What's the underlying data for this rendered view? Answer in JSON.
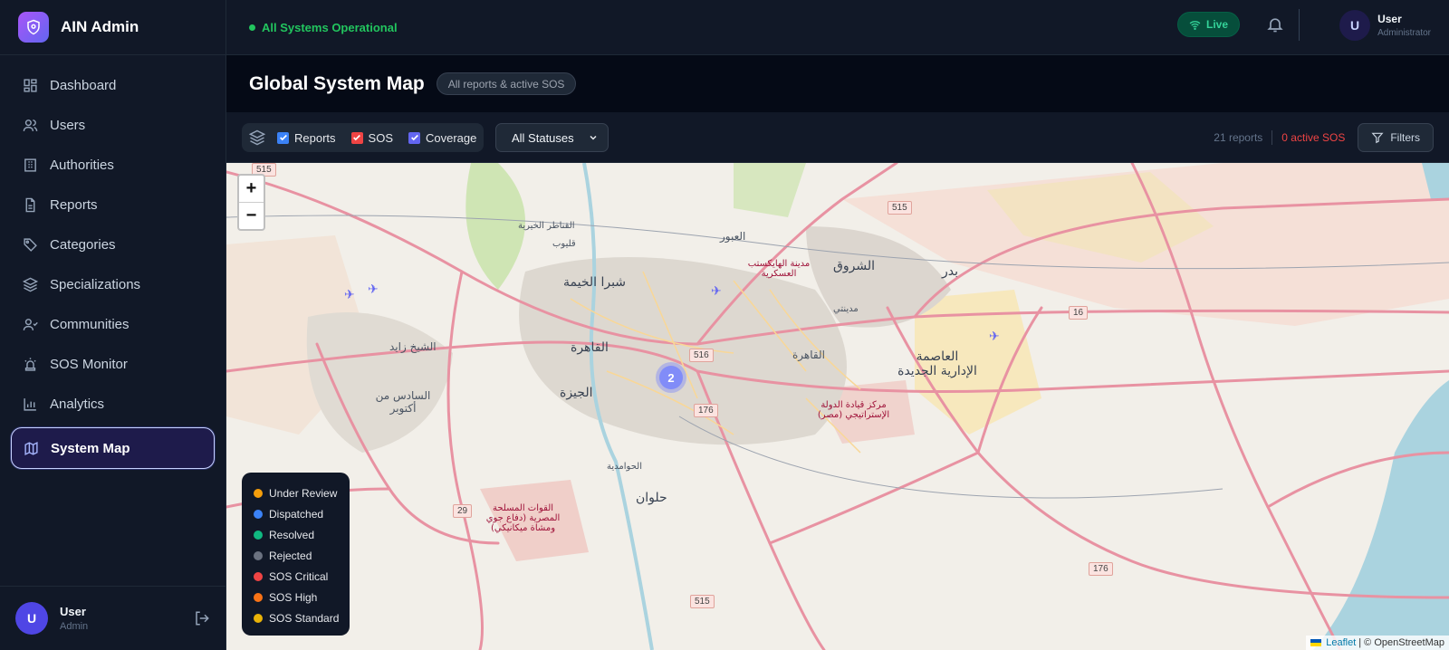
{
  "app": {
    "name": "AIN Admin"
  },
  "sidebar": {
    "items": [
      {
        "label": "Dashboard",
        "icon": "dashboard-icon"
      },
      {
        "label": "Users",
        "icon": "users-icon"
      },
      {
        "label": "Authorities",
        "icon": "building-icon"
      },
      {
        "label": "Reports",
        "icon": "file-icon"
      },
      {
        "label": "Categories",
        "icon": "tag-icon"
      },
      {
        "label": "Specializations",
        "icon": "layers-icon"
      },
      {
        "label": "Communities",
        "icon": "community-icon"
      },
      {
        "label": "SOS Monitor",
        "icon": "siren-icon"
      },
      {
        "label": "Analytics",
        "icon": "chart-icon"
      },
      {
        "label": "System Map",
        "icon": "map-icon",
        "active": true
      }
    ],
    "footer": {
      "avatar": "U",
      "name": "User",
      "role": "Admin"
    }
  },
  "topbar": {
    "status": "All Systems Operational",
    "live": "Live",
    "user": {
      "avatar": "U",
      "name": "User",
      "role": "Administrator"
    }
  },
  "page": {
    "title": "Global System Map",
    "subtitle": "All reports & active SOS"
  },
  "toolbar": {
    "layers": [
      {
        "label": "Reports",
        "checked": true,
        "color": "#3b82f6"
      },
      {
        "label": "SOS",
        "checked": true,
        "color": "#ef4444"
      },
      {
        "label": "Coverage",
        "checked": true,
        "color": "#6366f1"
      }
    ],
    "status_select": "All Statuses",
    "report_count": "21 reports",
    "sos_count": "0 active SOS",
    "filters": "Filters"
  },
  "map": {
    "zoom_in": "+",
    "zoom_out": "−",
    "cluster_count": "2",
    "legend": [
      {
        "label": "Under Review",
        "color": "#f59e0b"
      },
      {
        "label": "Dispatched",
        "color": "#3b82f6"
      },
      {
        "label": "Resolved",
        "color": "#10b981"
      },
      {
        "label": "Rejected",
        "color": "#6b7280"
      },
      {
        "label": "SOS Critical",
        "color": "#ef4444"
      },
      {
        "label": "SOS High",
        "color": "#f97316"
      },
      {
        "label": "SOS Standard",
        "color": "#eab308"
      }
    ],
    "attribution": {
      "leaflet": "Leaflet",
      "osm": "| © OpenStreetMap"
    },
    "labels": {
      "cairo": "القاهرة",
      "giza": "الجيزة",
      "shubra": "شبرا الخيمة",
      "shorouk": "الشروق",
      "badr": "بدر",
      "obour": "العبور",
      "helwan": "حلوان",
      "sheikh_zayed": "الشيخ زايد",
      "october": "السادس من أكتوبر",
      "new_capital": "العاصمة الإدارية الجديدة",
      "hykestep": "مدينة الهايكستب العسكرية",
      "forces": "القوات المسلحة المصرية (دفاع جوي ومشاة ميكانيكي)",
      "strategic": "مركز قيادة الدولة الإستراتيجي (مصر)",
      "cairo_east": "القاهرة",
      "qanater": "القناطر الخيرية",
      "qalyub": "قليوب",
      "madinaty": "مدينتي",
      "hawamdia": "الحوامدية"
    },
    "shields": [
      "515",
      "515",
      "516",
      "176",
      "176",
      "29",
      "515",
      "16"
    ]
  }
}
